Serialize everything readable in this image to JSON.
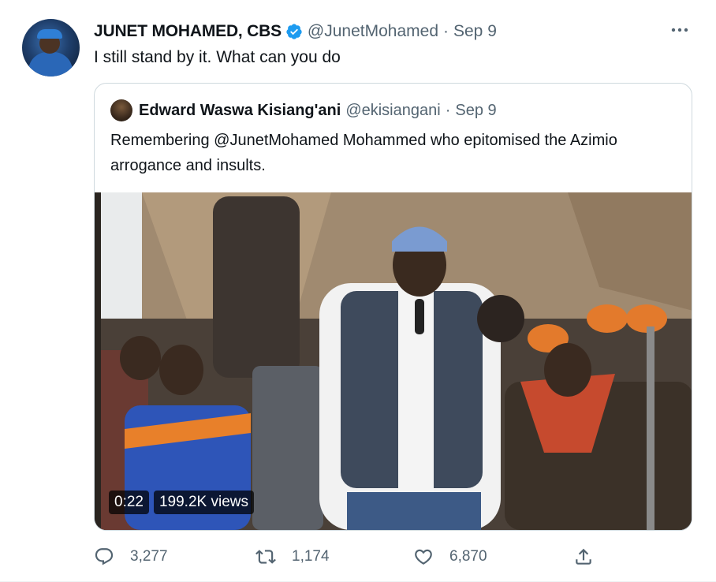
{
  "tweet": {
    "author_name": "JUNET MOHAMED, CBS",
    "author_handle": "@JunetMohamed",
    "time_sep": "·",
    "time": "Sep 9",
    "text": "I still stand by it. What can you do"
  },
  "quote": {
    "author_name": "Edward Waswa Kisiang'ani",
    "author_handle": "@ekisiangani",
    "time_sep": "·",
    "time": "Sep 9",
    "text": "Remembering  @JunetMohamed  Mohammed who epitomised  the Azimio arrogance and insults.",
    "video": {
      "duration": "0:22",
      "views": "199.2K views"
    }
  },
  "actions": {
    "replies": "3,277",
    "retweets": "1,174",
    "likes": "6,870"
  },
  "icons": {
    "verified": "verified-badge-icon",
    "more": "more-dots-icon",
    "reply": "reply-icon",
    "retweet": "retweet-icon",
    "like": "heart-icon",
    "share": "share-icon"
  },
  "colors": {
    "verified_blue": "#1d9bf0",
    "secondary_text": "#536471",
    "border": "#cfd9de"
  }
}
